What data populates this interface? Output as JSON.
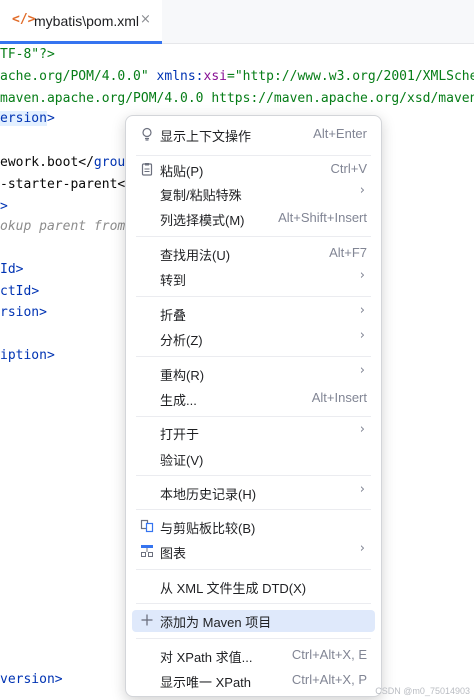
{
  "tab": {
    "icon": "</>",
    "label": "mybatis\\pom.xml",
    "close": "×"
  },
  "code": {
    "l1": "TF-8\"?>",
    "l2a": "ache.org/POM/4.0.0\" ",
    "l2b": "xmlns:",
    "l2c": "xsi",
    "l2d": "=\"http://www.w3.org/2001/XMLSche",
    "l3": "maven.apache.org/POM/4.0.0 https://maven.apache.org/xsd/maven",
    "l4a": "ersion",
    "l4b": ">",
    "l5a": "ework.boot</",
    "l5b": "grou",
    "l6a": "-starter-parent<",
    "l7": ">",
    "l8": "okup parent from",
    "l9a": "Id",
    "l9b": ">",
    "l10a": "ctId",
    "l10b": ">",
    "l11a": "rsion",
    "l11b": ">",
    "l12a": "iption",
    "l12b": ">",
    "l13a": "version",
    "l13b": ">"
  },
  "menu": {
    "items": [
      {
        "label": "显示上下文操作",
        "shortcut": "Alt+Enter",
        "icon": "lightbulb-icon"
      },
      {
        "label": "粘贴(P)",
        "shortcut": "Ctrl+V",
        "icon": "clipboard-icon"
      },
      {
        "label": "复制/粘贴特殊",
        "arrow": "›"
      },
      {
        "label": "列选择模式(M)",
        "shortcut": "Alt+Shift+Insert"
      },
      {
        "label": "查找用法(U)",
        "shortcut": "Alt+F7"
      },
      {
        "label": "转到",
        "arrow": "›"
      },
      {
        "label": "折叠",
        "arrow": "›"
      },
      {
        "label": "分析(Z)",
        "arrow": "›"
      },
      {
        "label": "重构(R)",
        "arrow": "›"
      },
      {
        "label": "生成...",
        "shortcut": "Alt+Insert"
      },
      {
        "label": "打开于",
        "arrow": "›"
      },
      {
        "label": "验证(V)"
      },
      {
        "label": "本地历史记录(H)",
        "arrow": "›"
      },
      {
        "label": "与剪贴板比较(B)",
        "icon": "compare-icon"
      },
      {
        "label": "图表",
        "arrow": "›",
        "icon": "diagram-icon"
      },
      {
        "label": "从 XML 文件生成 DTD(X)"
      },
      {
        "label": "添加为 Maven 项目",
        "icon": "plus-icon"
      },
      {
        "label": "对 XPath 求值...",
        "shortcut": "Ctrl+Alt+X, E"
      },
      {
        "label": "显示唯一 XPath",
        "shortcut": "Ctrl+Alt+X, P"
      }
    ]
  },
  "watermark": "CSDN @m0_75014903",
  "colors": {
    "accent": "#3574f0",
    "hover": "#dfe9fb",
    "string": "#067d17",
    "attribute": "#871094",
    "tag": "#0033b3"
  }
}
